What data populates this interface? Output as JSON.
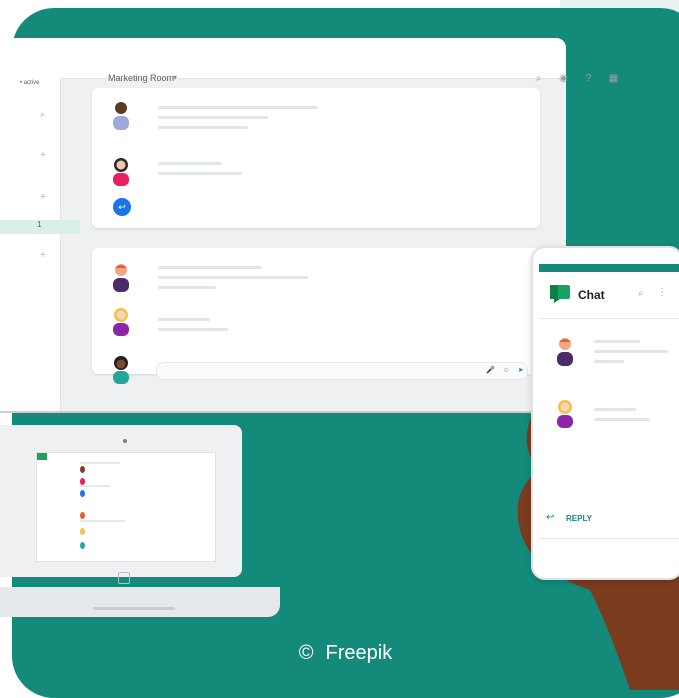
{
  "monitor": {
    "room_title": "Marketing Room",
    "status_label": "• active",
    "unread_count": "1"
  },
  "phone": {
    "app_title": "Chat",
    "reply_label": "REPLY"
  },
  "credit": {
    "symbol": "©",
    "text": "Freepik"
  },
  "colors": {
    "background": "#148a7a",
    "accent_blue": "#1a73e8",
    "chat_green": "#1aa260"
  }
}
